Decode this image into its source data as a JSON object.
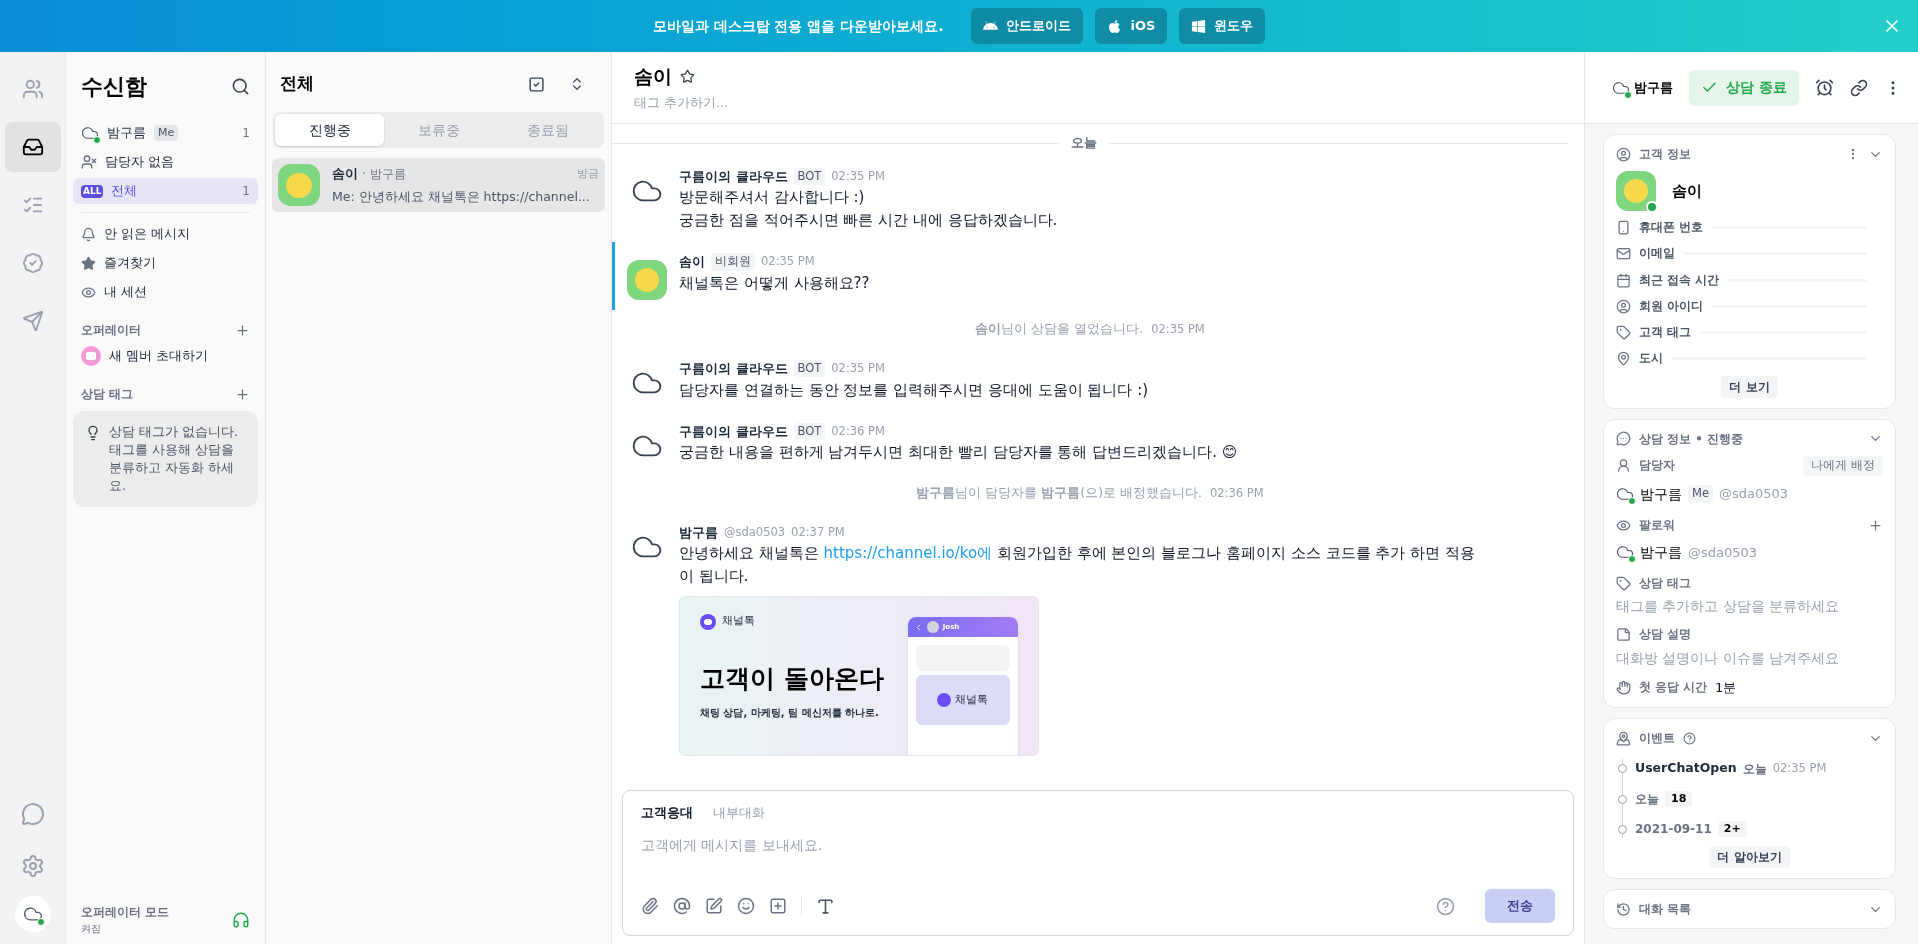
{
  "banner": {
    "message": "모바일과 데스크탑 전용 앱을 다운받아보세요.",
    "buttons": [
      {
        "kind": "android",
        "label": "안드로이드"
      },
      {
        "kind": "ios",
        "label": "iOS"
      },
      {
        "kind": "windows",
        "label": "윈도우"
      }
    ]
  },
  "rail": {
    "items": [
      {
        "kind": "users",
        "selected": false
      },
      {
        "kind": "inbox",
        "selected": true
      },
      {
        "kind": "list",
        "selected": false
      },
      {
        "kind": "badge",
        "selected": false
      },
      {
        "kind": "send",
        "selected": false
      }
    ],
    "bottom": [
      {
        "kind": "chat"
      },
      {
        "kind": "settings"
      },
      {
        "kind": "profile"
      }
    ]
  },
  "sidebar": {
    "title": "수신함",
    "top_items": [
      {
        "kind": "operator",
        "label": "밤구름",
        "badge": "Me",
        "count": "1",
        "selected": false
      },
      {
        "kind": "unassigned",
        "label": "담당자 없음",
        "selected": false
      },
      {
        "kind": "all",
        "icon_label": "ALL",
        "label": "전체",
        "count": "1",
        "selected": true
      }
    ],
    "items": [
      {
        "kind": "unread",
        "label": "안 읽은 메시지"
      },
      {
        "kind": "favorite",
        "label": "즐겨찾기"
      },
      {
        "kind": "session",
        "label": "내 세션"
      }
    ],
    "operator_section": {
      "title": "오퍼레이터",
      "invite": "새 멤버 초대하기"
    },
    "tag_section": {
      "title": "상담 태그",
      "empty": "상담 태그가 없습니다. 태그를 사용해 상담을 분류하고 자동화 하세요."
    },
    "footer": {
      "title": "오퍼레이터 모드",
      "status": "켜짐"
    }
  },
  "chat_list": {
    "title": "전체",
    "tabs": [
      {
        "label": "진행중",
        "selected": true
      },
      {
        "label": "보류중",
        "selected": false
      },
      {
        "label": "종료됨",
        "selected": false
      }
    ],
    "chats": [
      {
        "name": "솜이",
        "meta": "· 밤구름",
        "time": "방금",
        "preview": "Me: 안녕하세요 채널톡은 https://channel...",
        "selected": true
      }
    ]
  },
  "chat": {
    "name": "솜이",
    "tag_placeholder": "태그 추가하기...",
    "assignee": "밤구름",
    "close_button": "상담 종료",
    "date_divider": "오늘",
    "messages": [
      {
        "kind": "bot",
        "author": "구름이의 클라우드",
        "badge": "BOT",
        "time": "02:35 PM",
        "lines": [
          "방문해주셔서 감사합니다 :)",
          "궁금한 점을 적어주시면 빠른 시간 내에 응답하겠습니다."
        ]
      },
      {
        "kind": "user",
        "author": "솜이",
        "badge": "비회원",
        "time": "02:35 PM",
        "lines": [
          "채널톡은 어떻게 사용해요??"
        ]
      },
      {
        "kind": "system",
        "text": "**솜이**님이 상담을 열었습니다.",
        "time": "02:35 PM"
      },
      {
        "kind": "bot",
        "author": "구름이의 클라우드",
        "badge": "BOT",
        "time": "02:35 PM",
        "lines": [
          "담당자를 연결하는 동안 정보를 입력해주시면 응대에 도움이 됩니다 :)"
        ]
      },
      {
        "kind": "bot",
        "author": "구름이의 클라우드",
        "badge": "BOT",
        "time": "02:36 PM",
        "lines": [
          "궁금한 내용을 편하게 남겨두시면 최대한 빨리 담당자를 통해 답변드리겠습니다. 😊"
        ]
      },
      {
        "kind": "system",
        "text": "**밤구름**님이 담당자를 **밤구름**(으)로 배정했습니다.",
        "time": "02:36 PM"
      },
      {
        "kind": "operator",
        "author": "밤구름",
        "handle": "@sda0503",
        "time": "02:37 PM",
        "text_before": "안녕하세요 채널톡은 ",
        "link": "https://channel.io/ko에",
        "text_after": " 회원가입한 후에 본인의 블로그나 홈페이지 소스 코드를 추가 하면 적용이 됩니다.",
        "attachment": {
          "logo_text": "채널톡",
          "headline": "고객이 돌아온다",
          "subline": "채팅 상담, 마케팅, 팀 메신저를 하나로.",
          "phone": {
            "name": "Josh",
            "logo_text": "채널톡"
          }
        }
      }
    ],
    "composer": {
      "tabs": [
        {
          "label": "고객응대",
          "selected": true
        },
        {
          "label": "내부대화",
          "selected": false
        }
      ],
      "placeholder": "고객에게 메시지를 보내세요.",
      "send": "전송",
      "send_disabled": true
    }
  },
  "profile": {
    "title": "고객 정보",
    "name": "솜이",
    "online": true,
    "fields": [
      {
        "kind": "phone",
        "label": "휴대폰 번호"
      },
      {
        "kind": "email",
        "label": "이메일"
      },
      {
        "kind": "calendar",
        "label": "최근 접속 시간"
      },
      {
        "kind": "member",
        "label": "회원 아이디"
      },
      {
        "kind": "tag",
        "label": "고객 태그"
      },
      {
        "kind": "city",
        "label": "도시"
      }
    ],
    "more": "더 보기"
  },
  "chat_info": {
    "title": "상담 정보 • 진행중",
    "assignee_label": "담당자",
    "assign_me": "나에게 배정",
    "assignee": {
      "name": "밤구름",
      "badge": "Me",
      "handle": "@sda0503"
    },
    "followers_label": "팔로워",
    "follower": {
      "name": "밤구름",
      "handle": "@sda0503"
    },
    "tag_label": "상담 태그",
    "tag_placeholder": "태그를 추가하고 상담을 분류하세요",
    "desc_label": "상담 설명",
    "desc_placeholder": "대화방 설명이나 이슈를 남겨주세요",
    "first_response_label": "첫 응답 시간",
    "first_response": "1분"
  },
  "events": {
    "title": "이벤트",
    "items": [
      {
        "name": "UserChatOpen",
        "date": "오늘",
        "time": "02:35 PM"
      },
      {
        "date": "오늘",
        "count": "18"
      },
      {
        "date": "2021-09-11",
        "count": "2+"
      }
    ],
    "more": "더 알아보기"
  },
  "history": {
    "title": "대화 목록"
  }
}
